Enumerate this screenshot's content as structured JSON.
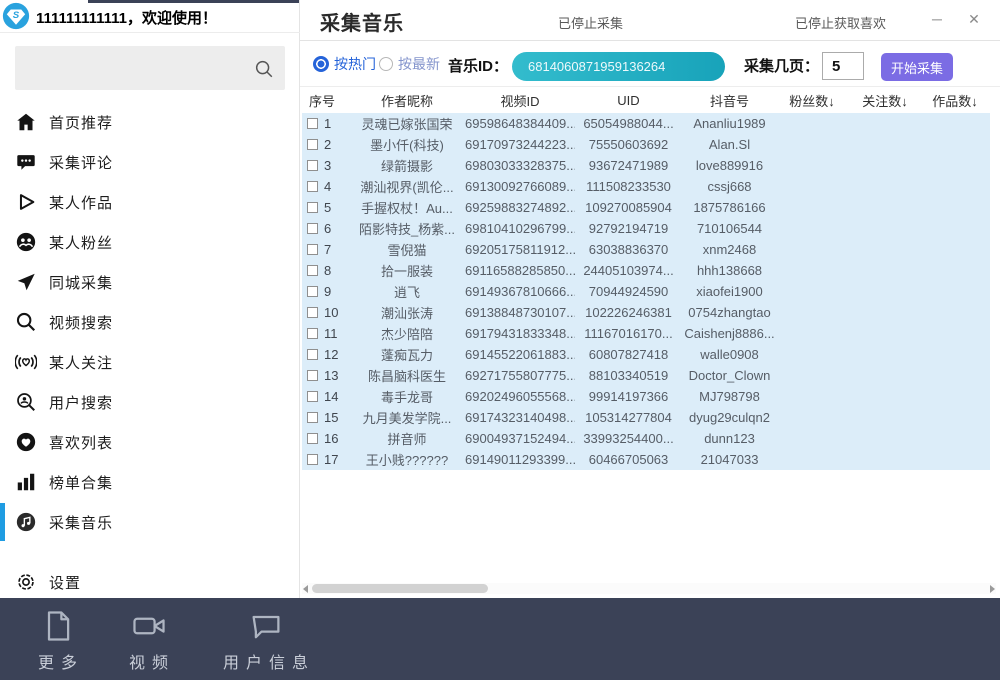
{
  "window": {
    "user_greeting": "111111111111，欢迎使用！",
    "title": "采集音乐",
    "status_collect": "已停止采集",
    "status_likes": "已停止获取喜欢",
    "minimize_glyph": "─",
    "close_glyph": "✕"
  },
  "sidebar": {
    "items": [
      {
        "label": "首页推荐",
        "icon": "home-icon"
      },
      {
        "label": "采集评论",
        "icon": "comment-icon"
      },
      {
        "label": "某人作品",
        "icon": "play-icon"
      },
      {
        "label": "某人粉丝",
        "icon": "fans-icon"
      },
      {
        "label": "同城采集",
        "icon": "send-icon"
      },
      {
        "label": "视频搜索",
        "icon": "search-icon"
      },
      {
        "label": "某人关注",
        "icon": "broadcast-heart-icon"
      },
      {
        "label": "用户搜索",
        "icon": "user-search-icon"
      },
      {
        "label": "喜欢列表",
        "icon": "heart-circle-icon"
      },
      {
        "label": "榜单合集",
        "icon": "bar-chart-icon"
      },
      {
        "label": "采集音乐",
        "icon": "music-circle-icon",
        "active": true
      }
    ],
    "settings_label": "设置"
  },
  "toolbar": {
    "sort_hot_label": "按热门",
    "sort_new_label": "按最新",
    "music_id_label": "音乐ID：",
    "music_id_value": "6814060871959136264",
    "pages_label": "采集几页：",
    "pages_value": "5",
    "start_button": "开始采集"
  },
  "table": {
    "headers": [
      "序号",
      "作者昵称",
      "视频ID",
      "UID",
      "抖音号",
      "粉丝数↓",
      "关注数↓",
      "作品数↓"
    ],
    "rows": [
      {
        "num": "1",
        "nickname": "灵魂已嫁张国荣",
        "video_id": "69598648384409...",
        "uid": "65054988044...",
        "douyin_id": "Ananliu1989",
        "fans": "",
        "follows": "",
        "works": ""
      },
      {
        "num": "2",
        "nickname": "墨小仟(科技)",
        "video_id": "69170973244223...",
        "uid": "75550603692",
        "douyin_id": "Alan.Sl",
        "fans": "",
        "follows": "",
        "works": ""
      },
      {
        "num": "3",
        "nickname": "绿箭摄影",
        "video_id": "69803033328375...",
        "uid": "93672471989",
        "douyin_id": "love889916",
        "fans": "",
        "follows": "",
        "works": ""
      },
      {
        "num": "4",
        "nickname": "潮汕视界(凯伦...",
        "video_id": "69130092766089...",
        "uid": "111508233530",
        "douyin_id": "cssj668",
        "fans": "",
        "follows": "",
        "works": ""
      },
      {
        "num": "5",
        "nickname": "手握权杖！Au...",
        "video_id": "69259883274892...",
        "uid": "109270085904",
        "douyin_id": "1875786166",
        "fans": "",
        "follows": "",
        "works": ""
      },
      {
        "num": "6",
        "nickname": "陌影特技_杨紫...",
        "video_id": "69810410296799...",
        "uid": "92792194719",
        "douyin_id": "710106544",
        "fans": "",
        "follows": "",
        "works": ""
      },
      {
        "num": "7",
        "nickname": "雪倪猫",
        "video_id": "69205175811912...",
        "uid": "63038836370",
        "douyin_id": "xnm2468",
        "fans": "",
        "follows": "",
        "works": ""
      },
      {
        "num": "8",
        "nickname": "拾一服装",
        "video_id": "69116588285850...",
        "uid": "24405103974...",
        "douyin_id": "hhh138668",
        "fans": "",
        "follows": "",
        "works": ""
      },
      {
        "num": "9",
        "nickname": "逍飞",
        "video_id": "69149367810666...",
        "uid": "70944924590",
        "douyin_id": "xiaofei1900",
        "fans": "",
        "follows": "",
        "works": ""
      },
      {
        "num": "10",
        "nickname": "潮汕张涛",
        "video_id": "69138848730107...",
        "uid": "102226246381",
        "douyin_id": "0754zhangtao",
        "fans": "",
        "follows": "",
        "works": ""
      },
      {
        "num": "11",
        "nickname": "杰少陪陪",
        "video_id": "69179431833348...",
        "uid": "11167016170...",
        "douyin_id": "Caishenj8886...",
        "fans": "",
        "follows": "",
        "works": ""
      },
      {
        "num": "12",
        "nickname": "蓬痴瓦力",
        "video_id": "69145522061883...",
        "uid": "60807827418",
        "douyin_id": "walle0908",
        "fans": "",
        "follows": "",
        "works": ""
      },
      {
        "num": "13",
        "nickname": "陈昌脑科医生",
        "video_id": "69271755807775...",
        "uid": "88103340519",
        "douyin_id": "Doctor_Clown",
        "fans": "",
        "follows": "",
        "works": ""
      },
      {
        "num": "14",
        "nickname": "毒手龙哥",
        "video_id": "69202496055568...",
        "uid": "99914197366",
        "douyin_id": "MJ798798",
        "fans": "",
        "follows": "",
        "works": ""
      },
      {
        "num": "15",
        "nickname": "九月美发学院...",
        "video_id": "69174323140498...",
        "uid": "105314277804",
        "douyin_id": "dyug29culqn2",
        "fans": "",
        "follows": "",
        "works": ""
      },
      {
        "num": "16",
        "nickname": "拼音师",
        "video_id": "69004937152494...",
        "uid": "33993254400...",
        "douyin_id": "dunn123",
        "fans": "",
        "follows": "",
        "works": ""
      },
      {
        "num": "17",
        "nickname": "王小贱??????",
        "video_id": "69149011293399...",
        "uid": "60466705063",
        "douyin_id": "21047033",
        "fans": "",
        "follows": "",
        "works": ""
      }
    ]
  },
  "bottombar": {
    "items": [
      {
        "label": "更多",
        "icon": "document-icon"
      },
      {
        "label": "视频",
        "icon": "video-camera-icon"
      },
      {
        "label": "用户信息",
        "icon": "message-bubble-icon"
      }
    ]
  },
  "colors": {
    "accent_blue": "#1f9ce2",
    "link_blue": "#2563d9",
    "muted_blue": "#8494cc",
    "teal_input_start": "#33bccd",
    "teal_input_end": "#18a3ba",
    "purple_button": "#7b6ce4",
    "row_bg": "#dcedf9",
    "bottom_bar_bg": "#3b4257",
    "logo_blue": "#29a2de",
    "status_text": "#5a5a5a"
  }
}
